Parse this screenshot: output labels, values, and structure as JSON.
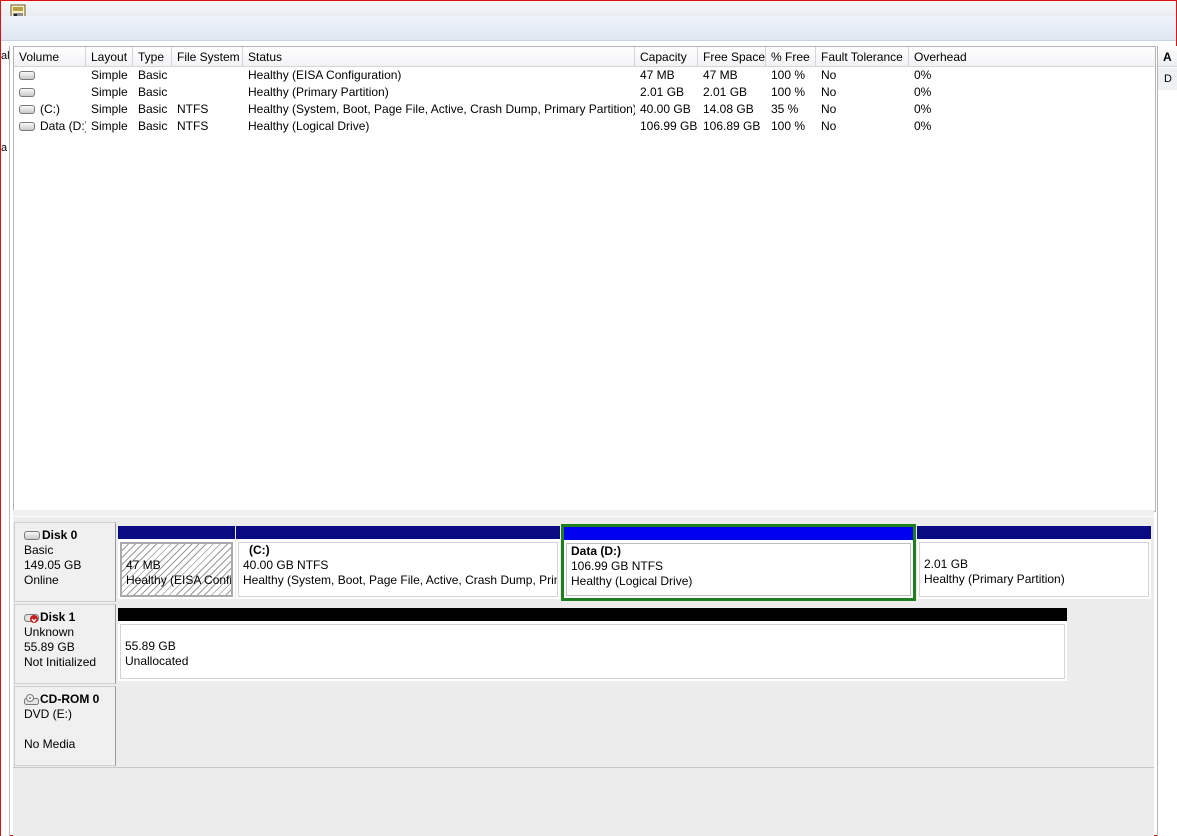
{
  "left_strip": {
    "items": [
      "al",
      "a"
    ]
  },
  "columns": [
    "Volume",
    "Layout",
    "Type",
    "File System",
    "Status",
    "Capacity",
    "Free Space",
    "% Free",
    "Fault Tolerance",
    "Overhead"
  ],
  "rows": [
    {
      "volume": "",
      "layout": "Simple",
      "type": "Basic",
      "fs": "",
      "status": "Healthy (EISA Configuration)",
      "capacity": "47 MB",
      "free": "47 MB",
      "pct": "100 %",
      "fault": "No",
      "overhead": "0%"
    },
    {
      "volume": "",
      "layout": "Simple",
      "type": "Basic",
      "fs": "",
      "status": "Healthy (Primary Partition)",
      "capacity": "2.01 GB",
      "free": "2.01 GB",
      "pct": "100 %",
      "fault": "No",
      "overhead": "0%"
    },
    {
      "volume": "(C:)",
      "layout": "Simple",
      "type": "Basic",
      "fs": "NTFS",
      "status": "Healthy (System, Boot, Page File, Active, Crash Dump, Primary Partition)",
      "capacity": "40.00 GB",
      "free": "14.08 GB",
      "pct": "35 %",
      "fault": "No",
      "overhead": "0%"
    },
    {
      "volume": "Data (D:)",
      "layout": "Simple",
      "type": "Basic",
      "fs": "NTFS",
      "status": "Healthy (Logical Drive)",
      "capacity": "106.99 GB",
      "free": "106.89 GB",
      "pct": "100 %",
      "fault": "No",
      "overhead": "0%"
    }
  ],
  "disks": [
    {
      "name": "Disk 0",
      "kind": "Basic",
      "size": "149.05 GB",
      "state": "Online",
      "partitions": [
        {
          "title": "",
          "size": "47 MB",
          "status": "Healthy (EISA Confi"
        },
        {
          "title": "(C:)",
          "size": "40.00 GB NTFS",
          "status": "Healthy (System, Boot, Page File, Active, Crash Dump, Prim"
        },
        {
          "title": "Data  (D:)",
          "size": "106.99 GB NTFS",
          "status": "Healthy (Logical Drive)"
        },
        {
          "title": "",
          "size": "2.01 GB",
          "status": "Healthy (Primary Partition)"
        }
      ]
    },
    {
      "name": "Disk 1",
      "kind": "Unknown",
      "size": "55.89 GB",
      "state": "Not Initialized",
      "partitions": [
        {
          "title": "",
          "size": "55.89 GB",
          "status": "Unallocated"
        }
      ]
    },
    {
      "name": "CD-ROM 0",
      "kind": "DVD (E:)",
      "size": "",
      "state": "No Media",
      "partitions": []
    }
  ],
  "right_pane": {
    "header": "A",
    "item": "D"
  },
  "colors": {
    "primary_bar": "#0a0a82",
    "selected_bar": "#0000f0",
    "unallocated_bar": "#000000",
    "selection_border": "#1e7f1e",
    "window_border": "#e01010"
  },
  "icons": {
    "toolbar": "disk-management-icon",
    "disk": "hard-disk-icon",
    "disk_error": "disk-error-icon",
    "cdrom": "cdrom-icon"
  }
}
